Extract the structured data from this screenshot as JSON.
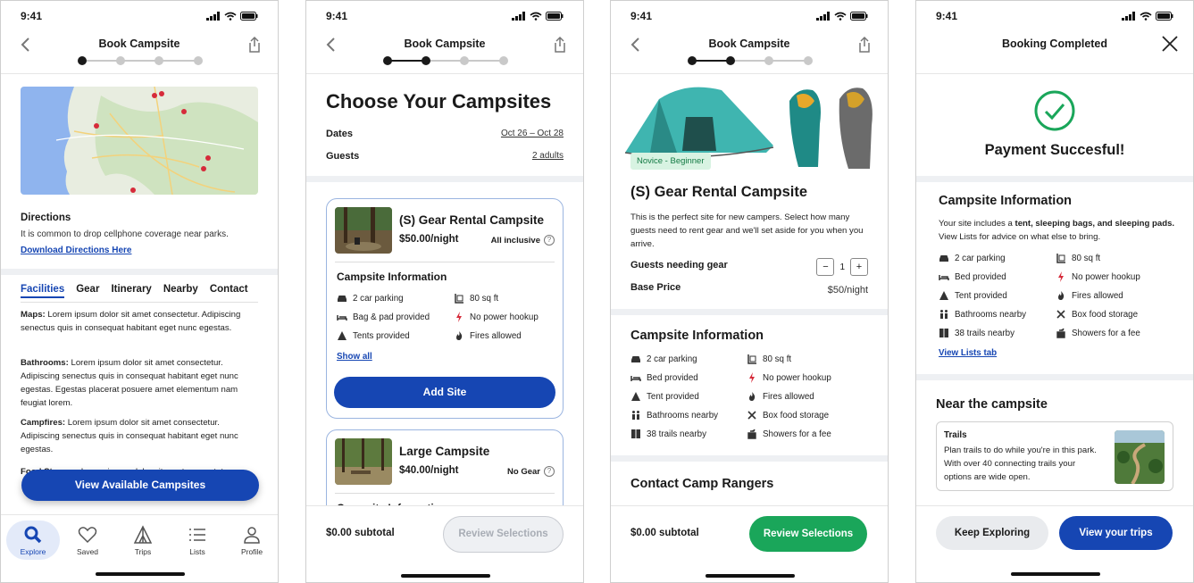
{
  "status": {
    "time": "9:41"
  },
  "screen1": {
    "header_title": "Book Campsite",
    "directions_title": "Directions",
    "directions_text": "It is common to drop cellphone coverage near parks.",
    "directions_link": "Download Directions Here",
    "tabs": [
      "Facilities",
      "Gear",
      "Itinerary",
      "Nearby",
      "Contact"
    ],
    "paragraphs": [
      {
        "label": "Maps:",
        "text": " Lorem ipsum dolor sit amet consectetur. Adipiscing senectus quis in consequat habitant eget nunc egestas."
      },
      {
        "label": "Bathrooms:",
        "text": " Lorem ipsum dolor sit amet consectetur. Adipiscing senectus quis in consequat habitant eget nunc egestas. Egestas placerat posuere amet elementum nam feugiat lorem."
      },
      {
        "label": "Campfires:",
        "text": " Lorem ipsum dolor sit amet consectetur. Adipiscing senectus quis in consequat habitant eget nunc egestas."
      },
      {
        "label": "Food Storage:",
        "text": " Lorem ipsum dolor sit amet consectetur."
      }
    ],
    "cta": "View Available Campsites",
    "nav": [
      "Explore",
      "Saved",
      "Trips",
      "Lists",
      "Profile"
    ]
  },
  "screen2": {
    "header_title": "Book Campsite",
    "title": "Choose Your Campsites",
    "dates_label": "Dates",
    "dates_value": "Oct 26 – Oct 28",
    "guests_label": "Guests",
    "guests_value": "2 adults",
    "card1": {
      "title": "(S) Gear Rental Campsite",
      "price": "$50.00/night",
      "tag": "All inclusive",
      "info_title": "Campsite Information",
      "amenities": [
        "2 car parking",
        "80 sq ft",
        "Bag & pad provided",
        "No power hookup",
        "Tents provided",
        "Fires allowed"
      ],
      "show_all": "Show all",
      "add": "Add Site"
    },
    "card2": {
      "title": "Large Campsite",
      "price": "$40.00/night",
      "tag": "No Gear",
      "info_title": "Campsite Information"
    },
    "subtotal": "$0.00 subtotal",
    "review": "Review Selections"
  },
  "screen3": {
    "header_title": "Book Campsite",
    "badge": "Novice - Beginner",
    "title": "(S) Gear Rental Campsite",
    "desc": "This is the perfect site for new campers. Select how many guests need to rent gear and we'll set aside for you when you arrive.",
    "guests_gear_label": "Guests needing gear",
    "qty": "1",
    "minus": "−",
    "plus": "+",
    "base_label": "Base Price",
    "base_value": "$50/night",
    "info_title": "Campsite Information",
    "amenities": [
      "2 car parking",
      "80 sq ft",
      "Bed provided",
      "No power hookup",
      "Tent provided",
      "Fires allowed",
      "Bathrooms nearby",
      "Box food storage",
      "38 trails nearby",
      "Showers for a fee"
    ],
    "contact_title": "Contact Camp Rangers",
    "subtotal": "$0.00 subtotal",
    "review": "Review Selections"
  },
  "screen4": {
    "header_title": "Booking Completed",
    "pay_title": "Payment Succesful!",
    "info_title": "Campsite Information",
    "info_lead": "Your site includes a ",
    "info_bold": "tent, sleeping bags, and sleeping pads.",
    "info_tail": " View Lists for advice on what else to bring.",
    "amenities": [
      "2 car parking",
      "80 sq ft",
      "Bed provided",
      "No power hookup",
      "Tent provided",
      "Fires allowed",
      "Bathrooms nearby",
      "Box food storage",
      "38 trails nearby",
      "Showers for a fee"
    ],
    "lists_link": "View Lists tab",
    "near_title": "Near the campsite",
    "trail_title": "Trails",
    "trail_desc": "Plan trails to do while you're in this park. With over 40 connecting trails your options are wide open.",
    "keep": "Keep Exploring",
    "trips": "View your trips"
  },
  "colors": {
    "primary": "#1646b3",
    "success": "#1aa65a",
    "badge_bg": "#d8f3e2"
  }
}
